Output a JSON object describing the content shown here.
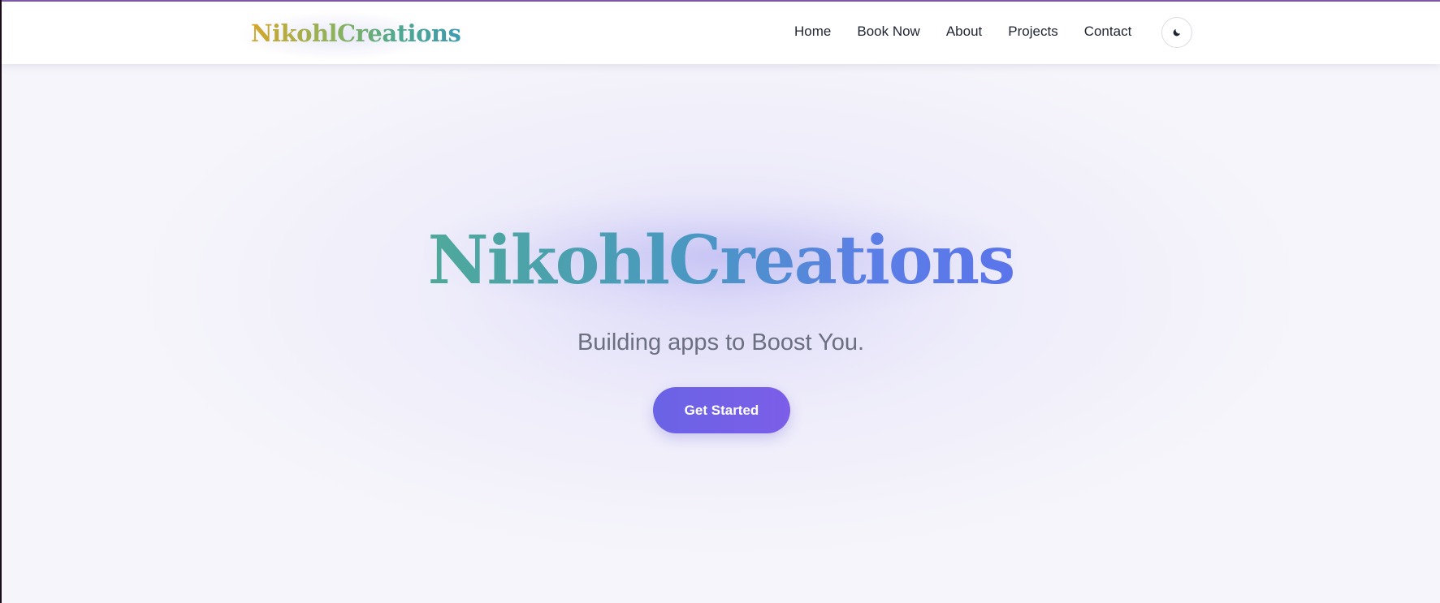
{
  "navbar": {
    "logo_text": "NikohlCreations",
    "links": [
      {
        "label": "Home"
      },
      {
        "label": "Book Now"
      },
      {
        "label": "About"
      },
      {
        "label": "Projects"
      },
      {
        "label": "Contact"
      }
    ],
    "theme_toggle_icon": "moon-icon"
  },
  "hero": {
    "title": "NikohlCreations",
    "subtitle": "Building apps to Boost You.",
    "cta_label": "Get Started"
  },
  "colors": {
    "accent": "#6a63e6",
    "accent_end": "#7c5ee8",
    "logo_gradient_start": "#d4a72c",
    "logo_gradient_end": "#3f9bb2",
    "title_gradient_start": "#4ea99a",
    "title_gradient_end": "#5b74ea",
    "nav_text": "#1f2433",
    "subtitle_text": "#6b6f80",
    "background": "#f6f5fb"
  }
}
